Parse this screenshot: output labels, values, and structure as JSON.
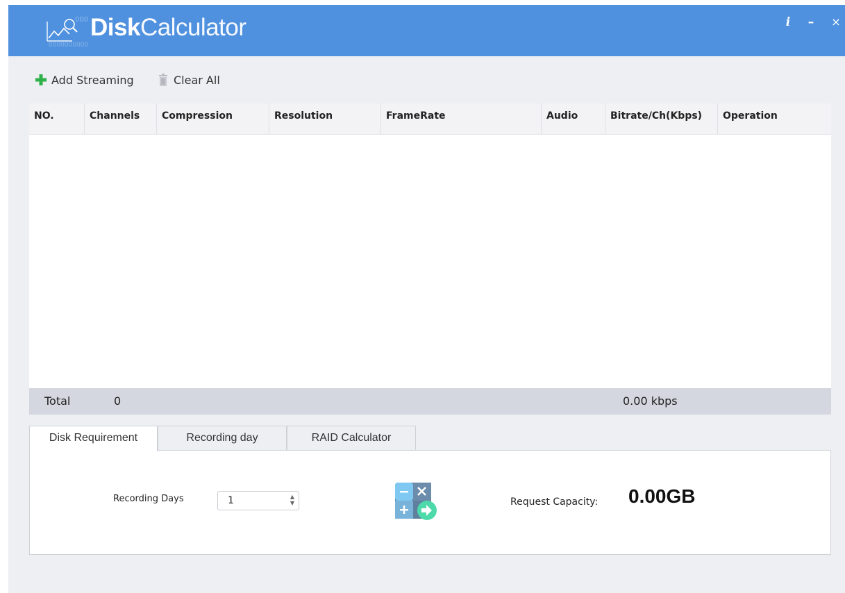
{
  "app": {
    "title_bold": "Disk",
    "title_light": "Calculator",
    "window_controls": {
      "info": "i",
      "minimize": "–",
      "close": "×"
    }
  },
  "toolbar": {
    "add_label": "Add Streaming",
    "clear_label": "Clear All",
    "add_icon": "plus-icon",
    "clear_icon": "trash-icon"
  },
  "table": {
    "columns": [
      "NO.",
      "Channels",
      "Compression",
      "Resolution",
      "FrameRate",
      "Audio",
      "Bitrate/Ch(Kbps)",
      "Operation"
    ],
    "rows": []
  },
  "total": {
    "label": "Total",
    "count": "0",
    "bitrate": "0.00 kbps"
  },
  "tabs": [
    {
      "label": "Disk Requirement",
      "active": true
    },
    {
      "label": "Recording day",
      "active": false
    },
    {
      "label": "RAID Calculator",
      "active": false
    }
  ],
  "disk_requirement": {
    "recording_days_label": "Recording Days",
    "recording_days_value": "1",
    "capacity_label": "Request Capacity:",
    "capacity_value": "0.00GB"
  },
  "colors": {
    "titlebar": "#4f91df",
    "add_icon": "#2fb14a",
    "calc_icon_light": "#7ec8f2",
    "calc_icon_dark": "#5f7f9f",
    "calc_arrow": "#4dd9a9"
  }
}
